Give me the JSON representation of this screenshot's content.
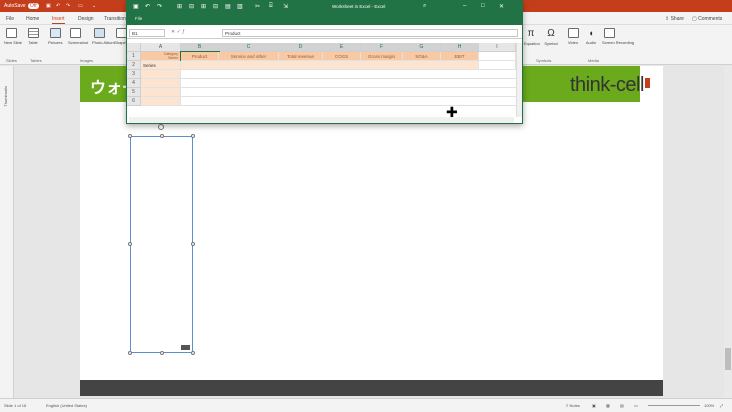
{
  "powerpoint": {
    "autosave": "AutoSave",
    "autosave_state": "Off",
    "tabs": [
      "File",
      "Home",
      "Insert",
      "Design",
      "Transitions"
    ],
    "active_tab": "Insert",
    "share": "Share",
    "comments": "Comments",
    "ribbon": {
      "new_slide": "New Slide",
      "table": "Table",
      "pictures": "Pictures",
      "screenshot": "Screenshot",
      "photo_album": "Photo Album",
      "shapes": "Shapes",
      "equation": "Equation",
      "symbol": "Symbol",
      "video": "Video",
      "audio": "Audio",
      "screen_recording": "Screen Recording",
      "groups": {
        "slides": "Slides",
        "tables": "Tables",
        "images": "Images",
        "symbols": "Symbols",
        "media": "Media"
      }
    },
    "thumbnails_label": "Thumbnails",
    "slide": {
      "title": "ウォー",
      "logo": "think-cell"
    },
    "status": {
      "slide_indicator": "Slide 1 of 16",
      "language": "English (United States)",
      "notes": "Notes",
      "zoom": "100%"
    }
  },
  "excel": {
    "title": "Worksheet in Excel - Excel",
    "name_box": "B1",
    "formula": "Product",
    "columns": [
      "A",
      "B",
      "C",
      "D",
      "E",
      "F",
      "G",
      "H",
      "I"
    ],
    "rows": [
      "1",
      "2",
      "3",
      "4",
      "5",
      "6"
    ],
    "header_row": [
      "Product",
      "Service and other",
      "Total revenue",
      "COGS",
      "Gross margin",
      "SG&A",
      "EBIT"
    ],
    "a1_top": "Category",
    "a1_bottom": "Series",
    "a2": "Series"
  },
  "colors": {
    "powerpoint_accent": "#c43e1c",
    "excel_accent": "#217346",
    "slide_title_bar": "#6aaa1c",
    "header_fill": "#f8c9a3"
  }
}
